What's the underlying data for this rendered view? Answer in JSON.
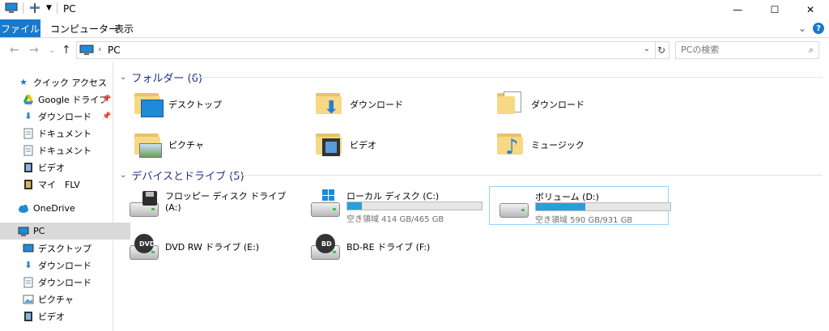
{
  "window": {
    "title": "PC",
    "minimize": "—",
    "maximize": "☐",
    "close": "✕"
  },
  "ribbon": {
    "tabs": [
      "ファイル",
      "コンピューター",
      "表示"
    ],
    "expand": "⌄",
    "help": "?"
  },
  "navigation": {
    "back": "←",
    "forward": "→",
    "recent": "⌄",
    "up": "↑",
    "breadcrumb": "PC",
    "search_placeholder": "PCの検索"
  },
  "sidebar": {
    "items": [
      {
        "label": "クイック アクセス",
        "icon": "star-icon",
        "pinned": false
      },
      {
        "label": "Google ドライブ",
        "icon": "google-drive-icon",
        "pinned": true
      },
      {
        "label": "ダウンロード",
        "icon": "download-icon",
        "pinned": true
      },
      {
        "label": "ドキュメント",
        "icon": "document-icon",
        "pinned": false
      },
      {
        "label": "ドキュメント",
        "icon": "document-icon",
        "pinned": false
      },
      {
        "label": "ビデオ",
        "icon": "video-icon",
        "pinned": false
      },
      {
        "label": "マイ　FLV",
        "icon": "video-icon",
        "pinned": false
      },
      {
        "label": "OneDrive",
        "icon": "cloud-icon",
        "pinned": false
      },
      {
        "label": "PC",
        "icon": "computer-icon",
        "pinned": false
      },
      {
        "label": "デスクトップ",
        "icon": "desktop-icon",
        "pinned": false
      },
      {
        "label": "ダウンロード",
        "icon": "download-icon",
        "pinned": false
      },
      {
        "label": "ダウンロード",
        "icon": "document-icon",
        "pinned": false
      },
      {
        "label": "ピクチャ",
        "icon": "picture-icon",
        "pinned": false
      },
      {
        "label": "ビデオ",
        "icon": "video-icon",
        "pinned": false
      }
    ],
    "selected": "PC"
  },
  "folders": {
    "header": "フォルダー (6)",
    "items": [
      {
        "label": "デスクトップ",
        "icon": "desktop-folder-icon"
      },
      {
        "label": "ダウンロード",
        "icon": "download-folder-icon"
      },
      {
        "label": "ダウンロード",
        "icon": "document-folder-icon"
      },
      {
        "label": "ピクチャ",
        "icon": "picture-folder-icon"
      },
      {
        "label": "ビデオ",
        "icon": "video-folder-icon"
      },
      {
        "label": "ミュージック",
        "icon": "music-folder-icon"
      }
    ]
  },
  "drives": {
    "header": "デバイスとドライブ (5)",
    "items": [
      {
        "label": "フロッピー ディスク ドライブ (A:)",
        "icon": "floppy-drive-icon"
      },
      {
        "label": "ローカル ディスク (C:)",
        "icon": "windows-drive-icon",
        "free": "空き領域 414 GB/465 GB",
        "used_fraction": 0.11
      },
      {
        "label": "ボリューム (D:)",
        "icon": "hard-drive-icon",
        "free": "空き領域 590 GB/931 GB",
        "used_fraction": 0.37
      },
      {
        "label": "DVD RW ドライブ (E:)",
        "icon": "dvd-drive-icon",
        "disc": "DVD"
      },
      {
        "label": "BD-RE ドライブ (F:)",
        "icon": "bd-drive-icon",
        "disc": "BD"
      }
    ]
  },
  "colors": {
    "accent": "#1979ca",
    "group_header": "#1e3287",
    "usage_bar": "#26a0da",
    "selection_border": "#99d1ff"
  }
}
